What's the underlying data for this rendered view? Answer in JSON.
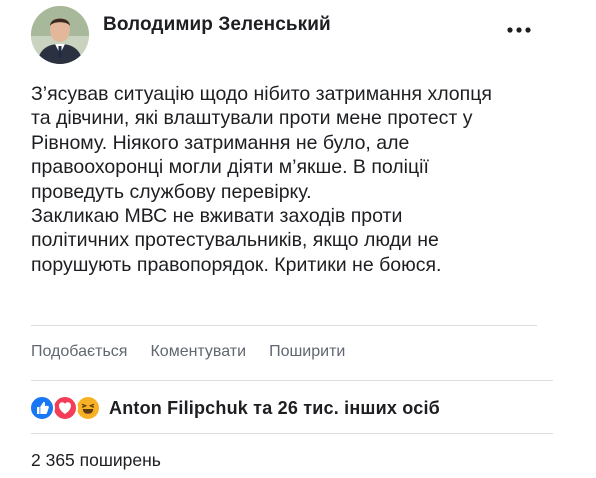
{
  "post": {
    "author": "Володимир Зеленський",
    "text_lines": [
      "З’ясував ситуацію щодо нібито затримання хлопця",
      "та дівчини, які влаштували проти мене протест у",
      "Рівному. Ніякого затримання не було, але",
      "правоохоронці могли діяти м’якше. В поліції",
      "проведуть службову перевірку.",
      "Закликаю МВС не вживати заходів проти",
      "політичних протестувальників, якщо люди не",
      "порушують правопорядок. Критики не боюся."
    ]
  },
  "actions": {
    "like": "Подобається",
    "comment": "Коментувати",
    "share": "Поширити"
  },
  "reactions": {
    "icons": [
      "like-reaction-icon",
      "love-reaction-icon",
      "haha-reaction-icon"
    ],
    "summary": "Anton Filipchuk та 26 тис. інших осіб"
  },
  "shares": {
    "count_label": "2 365 поширень"
  },
  "colors": {
    "text": "#1c1e21",
    "secondary": "#606770",
    "like_blue": "#1877f2",
    "love_red": "#f33e58",
    "haha_yellow": "#f7b125",
    "divider": "#dadde1"
  }
}
